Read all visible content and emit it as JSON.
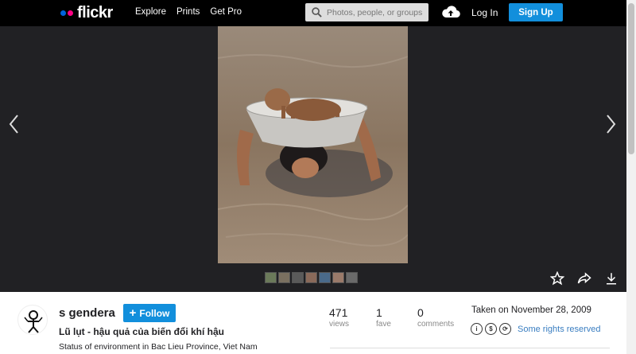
{
  "header": {
    "logo_text": "flickr",
    "nav": [
      "Explore",
      "Prints",
      "Get Pro"
    ],
    "search_placeholder": "Photos, people, or groups",
    "login_label": "Log In",
    "signup_label": "Sign Up"
  },
  "photo": {
    "filmstrip_count": 7
  },
  "owner": {
    "name": "s gendera",
    "follow_label": "Follow"
  },
  "details": {
    "title": "Lũ lụt - hậu quả của biến đổi khí hậu",
    "description": "Status of environment in Bac Lieu Province, Viet Nam"
  },
  "stats": [
    {
      "value": "471",
      "label": "views"
    },
    {
      "value": "1",
      "label": "fave"
    },
    {
      "value": "0",
      "label": "comments"
    }
  ],
  "taken": "Taken on November 28, 2009",
  "license": {
    "text": "Some rights reserved",
    "icons": [
      "cc-attribution-icon",
      "cc-noncommercial-icon",
      "cc-sharealike-icon"
    ]
  },
  "colors": {
    "accent": "#128fdc",
    "stage_bg": "#212124",
    "link": "#3a7ec1"
  }
}
